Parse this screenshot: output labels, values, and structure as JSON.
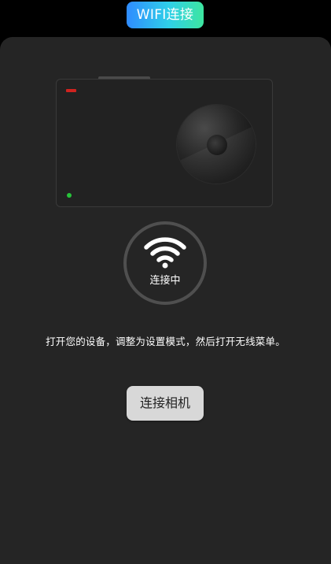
{
  "header": {
    "title": "WIFI连接"
  },
  "camera_illustration": {
    "icon": "action-camera-icon",
    "colors": {
      "indicator_red": "#d0231f",
      "indicator_green": "#27c43a"
    }
  },
  "wifi_indicator": {
    "icon": "wifi-icon",
    "status_text": "连接中"
  },
  "instructions": {
    "text": "打开您的设备，调整为设置模式，然后打开无线菜单。"
  },
  "actions": {
    "connect_label": "连接相机"
  },
  "colors": {
    "background": "#000000",
    "panel": "#252525",
    "title_gradient": [
      "#2f8cff",
      "#2fd0e8",
      "#3de6a0"
    ],
    "button_bg": "#d8d8d8"
  }
}
